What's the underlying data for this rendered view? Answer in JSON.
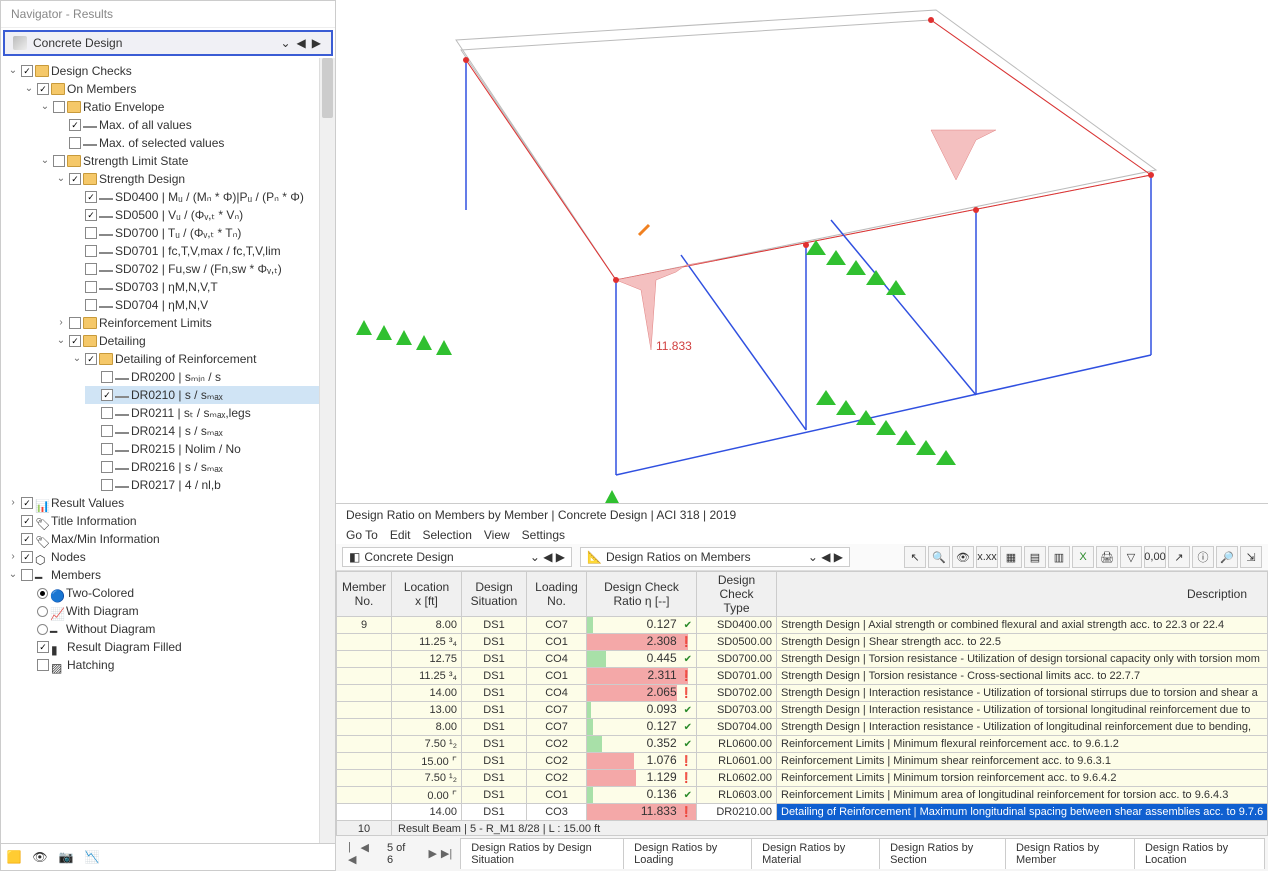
{
  "navigator": {
    "title": "Navigator - Results",
    "dropdown": "Concrete Design",
    "tree": {
      "design_checks": "Design Checks",
      "on_members": "On Members",
      "ratio_envelope": "Ratio Envelope",
      "max_all": "Max. of all values",
      "max_selected": "Max. of selected values",
      "strength_limit": "Strength Limit State",
      "strength_design": "Strength Design",
      "sd0400": "SD0400 | Mᵤ / (Mₙ * Φ)|Pᵤ / (Pₙ * Φ)",
      "sd0500": "SD0500 | Vᵤ / (Φᵥ,ₜ * Vₙ)",
      "sd0700": "SD0700 | Tᵤ / (Φᵥ,ₜ * Tₙ)",
      "sd0701": "SD0701 | fc,T,V,max / fc,T,V,lim",
      "sd0702": "SD0702 | Fu,sw / (Fn,sw * Φᵥ,ₜ)",
      "sd0703": "SD0703 | ηM,N,V,T",
      "sd0704": "SD0704 | ηM,N,V",
      "reinforcement_limits": "Reinforcement Limits",
      "detailing": "Detailing",
      "detailing_reinf": "Detailing of Reinforcement",
      "dr0200": "DR0200 | sₘᵢₙ / s",
      "dr0210": "DR0210 | s / sₘₐₓ",
      "dr0211": "DR0211 | sₜ / sₘₐₓ,legs",
      "dr0214": "DR0214 | s / sₘₐₓ",
      "dr0215": "DR0215 | Nolim / No",
      "dr0216": "DR0216 | s / sₘₐₓ",
      "dr0217": "DR0217 | 4 / nl,b",
      "result_values": "Result Values",
      "title_info": "Title Information",
      "maxmin_info": "Max/Min Information",
      "nodes": "Nodes",
      "members": "Members",
      "two_colored": "Two-Colored",
      "with_diagram": "With Diagram",
      "without_diagram": "Without Diagram",
      "result_diagram_filled": "Result Diagram Filled",
      "hatching": "Hatching"
    }
  },
  "viewport": {
    "annotation": "11.833"
  },
  "results": {
    "title": "Design Ratio on Members by Member | Concrete Design | ACI 318 | 2019",
    "menu": [
      "Go To",
      "Edit",
      "Selection",
      "View",
      "Settings"
    ],
    "dd1": "Concrete Design",
    "dd2": "Design Ratios on Members",
    "headers": {
      "member_no": "Member\nNo.",
      "location": "Location\nx [ft]",
      "design_sit": "Design\nSituation",
      "loading_no": "Loading\nNo.",
      "ratio": "Design Check\nRatio η [--]",
      "type": "Design Check\nType",
      "description": "Description"
    },
    "member_no": "9",
    "rows": [
      {
        "loc": "8.00",
        "ds": "DS1",
        "ld": "CO7",
        "ratio": 0.127,
        "ok": true,
        "type": "SD0400.00",
        "desc": "Strength Design | Axial strength or combined flexural and axial strength acc. to 22.3 or 22.4"
      },
      {
        "loc": "11.25 ³₄",
        "ds": "DS1",
        "ld": "CO1",
        "ratio": 2.308,
        "ok": false,
        "type": "SD0500.00",
        "desc": "Strength Design | Shear strength acc. to 22.5"
      },
      {
        "loc": "12.75",
        "ds": "DS1",
        "ld": "CO4",
        "ratio": 0.445,
        "ok": true,
        "type": "SD0700.00",
        "desc": "Strength Design | Torsion resistance - Utilization of design torsional capacity only with torsion mom"
      },
      {
        "loc": "11.25 ³₄",
        "ds": "DS1",
        "ld": "CO1",
        "ratio": 2.311,
        "ok": false,
        "type": "SD0701.00",
        "desc": "Strength Design | Torsion resistance - Cross-sectional limits acc. to 22.7.7"
      },
      {
        "loc": "14.00",
        "ds": "DS1",
        "ld": "CO4",
        "ratio": 2.065,
        "ok": false,
        "type": "SD0702.00",
        "desc": "Strength Design | Interaction resistance - Utilization of torsional stirrups due to torsion and shear a"
      },
      {
        "loc": "13.00",
        "ds": "DS1",
        "ld": "CO7",
        "ratio": 0.093,
        "ok": true,
        "type": "SD0703.00",
        "desc": "Strength Design | Interaction resistance - Utilization of torsional longitudinal reinforcement due to"
      },
      {
        "loc": "8.00",
        "ds": "DS1",
        "ld": "CO7",
        "ratio": 0.127,
        "ok": true,
        "type": "SD0704.00",
        "desc": "Strength Design | Interaction resistance - Utilization of longitudinal reinforcement due to bending,"
      },
      {
        "loc": "7.50 ¹₂",
        "ds": "DS1",
        "ld": "CO2",
        "ratio": 0.352,
        "ok": true,
        "type": "RL0600.00",
        "desc": "Reinforcement Limits | Minimum flexural reinforcement acc. to 9.6.1.2"
      },
      {
        "loc": "15.00 ⌜",
        "ds": "DS1",
        "ld": "CO2",
        "ratio": 1.076,
        "ok": false,
        "type": "RL0601.00",
        "desc": "Reinforcement Limits | Minimum shear reinforcement acc. to 9.6.3.1"
      },
      {
        "loc": "7.50 ¹₂",
        "ds": "DS1",
        "ld": "CO2",
        "ratio": 1.129,
        "ok": false,
        "type": "RL0602.00",
        "desc": "Reinforcement Limits | Minimum torsion reinforcement acc. to 9.6.4.2"
      },
      {
        "loc": "0.00 ⌜",
        "ds": "DS1",
        "ld": "CO1",
        "ratio": 0.136,
        "ok": true,
        "type": "RL0603.00",
        "desc": "Reinforcement Limits | Minimum area of longitudinal reinforcement for torsion acc. to 9.6.4.3"
      },
      {
        "loc": "14.00",
        "ds": "DS1",
        "ld": "CO3",
        "ratio": 11.833,
        "ok": false,
        "type": "DR0210.00",
        "desc": "Detailing of Reinforcement | Maximum longitudinal spacing between shear assemblies acc. to 9.7.6",
        "sel": true
      }
    ],
    "footer_no": "10",
    "footer_text": "Result Beam | 5 - R_M1 8/28 | L : 15.00 ft",
    "pager": "5 of 6",
    "tabs": [
      "Design Ratios by Design Situation",
      "Design Ratios by Loading",
      "Design Ratios by Material",
      "Design Ratios by Section",
      "Design Ratios by Member",
      "Design Ratios by Location"
    ]
  }
}
